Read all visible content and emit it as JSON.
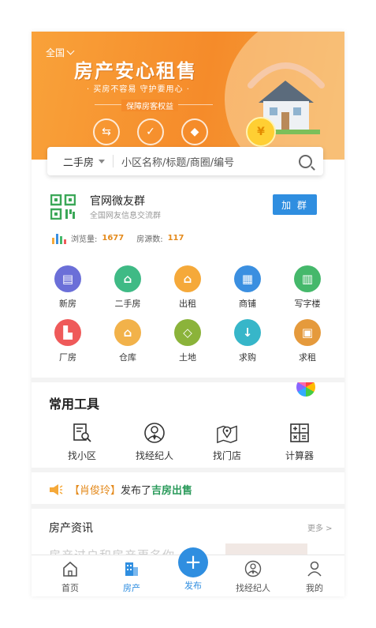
{
  "banner": {
    "region": "全国",
    "title": "房产安心租售",
    "subtitle": "· 买房不容易 守护要用心 ·",
    "tag": "保障房客权益",
    "coin_symbol": "¥"
  },
  "search": {
    "category": "二手房",
    "placeholder": "小区名称/标题/商圈/编号"
  },
  "group": {
    "title": "官网微友群",
    "subtitle": "全国网友信息交流群",
    "join_label": "加 群"
  },
  "stats": {
    "views_label": "浏览量:",
    "views": "1677",
    "listings_label": "房源数:",
    "listings": "117"
  },
  "categories": [
    {
      "label": "新房",
      "color": "#6b6fd8",
      "glyph": "▤"
    },
    {
      "label": "二手房",
      "color": "#3fba85",
      "glyph": "⌂"
    },
    {
      "label": "出租",
      "color": "#f5a93a",
      "glyph": "⌂"
    },
    {
      "label": "商铺",
      "color": "#3b8fe0",
      "glyph": "▦"
    },
    {
      "label": "写字楼",
      "color": "#45b86b",
      "glyph": "▥"
    },
    {
      "label": "厂房",
      "color": "#ef5a5a",
      "glyph": "▙"
    },
    {
      "label": "仓库",
      "color": "#f2b24a",
      "glyph": "⌂"
    },
    {
      "label": "土地",
      "color": "#8bb33a",
      "glyph": "◇"
    },
    {
      "label": "求购",
      "color": "#37b6c9",
      "glyph": "↓"
    },
    {
      "label": "求租",
      "color": "#e59a3c",
      "glyph": "▣"
    }
  ],
  "tools": {
    "title": "常用工具",
    "items": [
      {
        "label": "找小区"
      },
      {
        "label": "找经纪人"
      },
      {
        "label": "找门店"
      },
      {
        "label": "计算器"
      }
    ]
  },
  "notice": {
    "who": "【肖俊玲】",
    "verb": "发布了",
    "what": "吉房出售"
  },
  "news": {
    "title": "房产资讯",
    "more": "更多 >",
    "headline": "房产过户和房产更名你"
  },
  "tabbar": {
    "home": "首页",
    "property": "房产",
    "publish": "发布",
    "agent": "找经纪人",
    "mine": "我的",
    "publish_glyph": "+"
  },
  "colors": {
    "accent": "#2f8ee0",
    "banner": "#f58b2a",
    "highlight": "#e48a1c"
  }
}
